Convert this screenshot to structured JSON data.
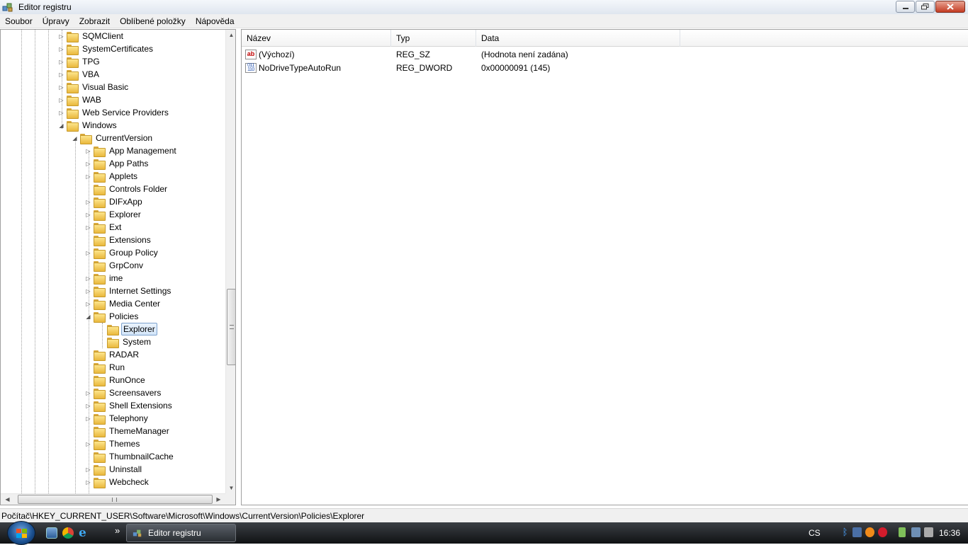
{
  "window": {
    "title": "Editor registru"
  },
  "menu": [
    "Soubor",
    "Úpravy",
    "Zobrazit",
    "Oblíbené položky",
    "Nápověda"
  ],
  "tree": {
    "items": [
      {
        "label": "SQMClient",
        "level": 0,
        "expander": "collapsed"
      },
      {
        "label": "SystemCertificates",
        "level": 0,
        "expander": "collapsed"
      },
      {
        "label": "TPG",
        "level": 0,
        "expander": "collapsed"
      },
      {
        "label": "VBA",
        "level": 0,
        "expander": "collapsed"
      },
      {
        "label": "Visual Basic",
        "level": 0,
        "expander": "collapsed"
      },
      {
        "label": "WAB",
        "level": 0,
        "expander": "collapsed"
      },
      {
        "label": "Web Service Providers",
        "level": 0,
        "expander": "collapsed"
      },
      {
        "label": "Windows",
        "level": 0,
        "expander": "expanded"
      },
      {
        "label": "CurrentVersion",
        "level": 1,
        "expander": "expanded"
      },
      {
        "label": "App Management",
        "level": 2,
        "expander": "collapsed"
      },
      {
        "label": "App Paths",
        "level": 2,
        "expander": "collapsed"
      },
      {
        "label": "Applets",
        "level": 2,
        "expander": "collapsed"
      },
      {
        "label": "Controls Folder",
        "level": 2,
        "expander": "none"
      },
      {
        "label": "DIFxApp",
        "level": 2,
        "expander": "collapsed"
      },
      {
        "label": "Explorer",
        "level": 2,
        "expander": "collapsed"
      },
      {
        "label": "Ext",
        "level": 2,
        "expander": "collapsed"
      },
      {
        "label": "Extensions",
        "level": 2,
        "expander": "none"
      },
      {
        "label": "Group Policy",
        "level": 2,
        "expander": "collapsed"
      },
      {
        "label": "GrpConv",
        "level": 2,
        "expander": "none"
      },
      {
        "label": "ime",
        "level": 2,
        "expander": "collapsed"
      },
      {
        "label": "Internet Settings",
        "level": 2,
        "expander": "collapsed"
      },
      {
        "label": "Media Center",
        "level": 2,
        "expander": "collapsed"
      },
      {
        "label": "Policies",
        "level": 2,
        "expander": "expanded"
      },
      {
        "label": "Explorer",
        "level": 3,
        "expander": "none",
        "selected": true
      },
      {
        "label": "System",
        "level": 3,
        "expander": "none"
      },
      {
        "label": "RADAR",
        "level": 2,
        "expander": "none"
      },
      {
        "label": "Run",
        "level": 2,
        "expander": "none"
      },
      {
        "label": "RunOnce",
        "level": 2,
        "expander": "none"
      },
      {
        "label": "Screensavers",
        "level": 2,
        "expander": "collapsed"
      },
      {
        "label": "Shell Extensions",
        "level": 2,
        "expander": "collapsed"
      },
      {
        "label": "Telephony",
        "level": 2,
        "expander": "collapsed"
      },
      {
        "label": "ThemeManager",
        "level": 2,
        "expander": "none"
      },
      {
        "label": "Themes",
        "level": 2,
        "expander": "collapsed"
      },
      {
        "label": "ThumbnailCache",
        "level": 2,
        "expander": "none"
      },
      {
        "label": "Uninstall",
        "level": 2,
        "expander": "collapsed"
      },
      {
        "label": "Webcheck",
        "level": 2,
        "expander": "collapsed"
      }
    ]
  },
  "list": {
    "columns": [
      "Název",
      "Typ",
      "Data"
    ],
    "rows": [
      {
        "icon": "string-value-icon",
        "name": "(Výchozí)",
        "type": "REG_SZ",
        "data": "(Hodnota není zadána)"
      },
      {
        "icon": "dword-value-icon",
        "name": "NoDriveTypeAutoRun",
        "type": "REG_DWORD",
        "data": "0x00000091 (145)"
      }
    ]
  },
  "status": {
    "path": "Počítač\\HKEY_CURRENT_USER\\Software\\Microsoft\\Windows\\CurrentVersion\\Policies\\Explorer"
  },
  "taskbar": {
    "quicklaunch_more": "»",
    "active_window": "Editor registru",
    "language": "CS",
    "clock": "16:36"
  },
  "colors": {
    "selection_border": "#7da2ce",
    "taskbar_bg": "#1b1e21"
  }
}
